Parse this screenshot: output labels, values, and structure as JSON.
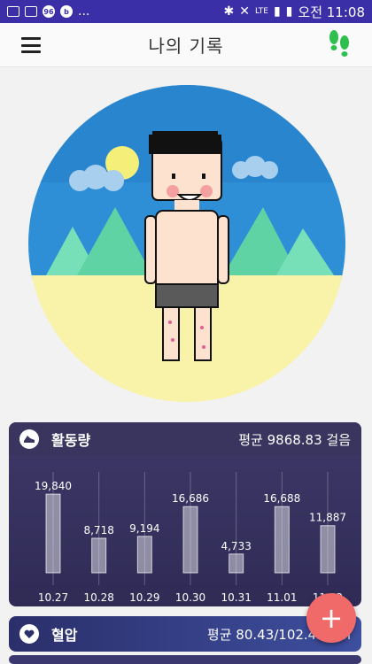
{
  "status_bar": {
    "left_text": "...",
    "network": "LTE",
    "time": "오전 11:08"
  },
  "app_bar": {
    "title": "나의 기록"
  },
  "activity_card": {
    "title": "활동량",
    "average": "평균 9868.83 걸음"
  },
  "chart_data": {
    "type": "bar",
    "categories": [
      "10.27",
      "10.28",
      "10.29",
      "10.30",
      "10.31",
      "11.01",
      "11.02"
    ],
    "values": [
      19840,
      8718,
      9194,
      16686,
      4733,
      16688,
      11887
    ],
    "value_labels": [
      "19,840",
      "8,718",
      "9,194",
      "16,686",
      "4,733",
      "16,688",
      "11,887"
    ],
    "ylim": [
      0,
      45000
    ]
  },
  "bp_card": {
    "title": "혈압",
    "average": "평균 80.43/102.43mm"
  },
  "fab": {
    "label": "+"
  },
  "colors": {
    "status_bar": "#3a2fa6",
    "card": "#3e3868",
    "fab": "#f06a6a",
    "steps_icon": "#2fbf4f"
  }
}
